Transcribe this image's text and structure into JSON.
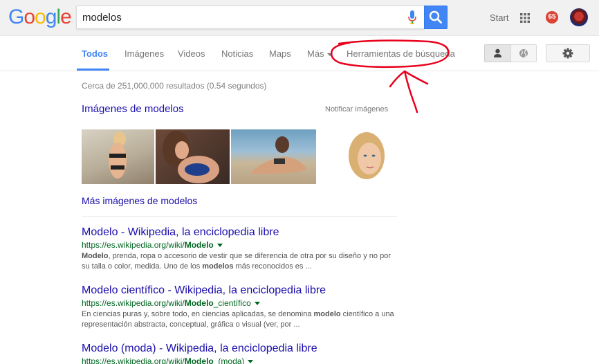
{
  "header": {
    "logo_letters": [
      {
        "char": "G",
        "color": "#4285f4"
      },
      {
        "char": "o",
        "color": "#ea4335"
      },
      {
        "char": "o",
        "color": "#fbbc05"
      },
      {
        "char": "g",
        "color": "#4285f4"
      },
      {
        "char": "l",
        "color": "#34a853"
      },
      {
        "char": "e",
        "color": "#ea4335"
      }
    ],
    "search_value": "modelos",
    "start_label": "Start",
    "notifications_count": "65"
  },
  "nav": {
    "tabs": [
      "Todos",
      "Imágenes",
      "Videos",
      "Noticias",
      "Maps",
      "Más",
      "Herramientas de búsqueda"
    ]
  },
  "results": {
    "stats": "Cerca de 251,000,000 resultados (0.54 segundos)",
    "images_heading": "Imágenes de modelos",
    "report_images": "Notificar imágenes",
    "more_images": "Más imágenes de modelos",
    "items": [
      {
        "title": "Modelo - Wikipedia, la enciclopedia libre",
        "url_prefix": "https://es.wikipedia.org/wiki/",
        "url_bold": "Modelo",
        "url_suffix": "",
        "snippet_bold1": "Modelo",
        "snippet_a": ", prenda, ropa o accesorio de vestir que se diferencia de otra por su diseño y no por su talla o color, medida. Uno de los ",
        "snippet_bold2": "modelos",
        "snippet_b": " más reconocidos es ..."
      },
      {
        "title": "Modelo científico - Wikipedia, la enciclopedia libre",
        "url_prefix": "https://es.wikipedia.org/wiki/",
        "url_bold": "Modelo",
        "url_suffix": "_científico",
        "snippet_bold1": "",
        "snippet_a": "En ciencias puras y, sobre todo, en ciencias aplicadas, se denomina ",
        "snippet_bold2": "modelo",
        "snippet_b": " científico a una representación abstracta, conceptual, gráfica o visual (ver, por ..."
      },
      {
        "title": "Modelo (moda) - Wikipedia, la enciclopedia libre",
        "url_prefix": "https://es.wikipedia.org/wiki/",
        "url_bold": "Modelo",
        "url_suffix": "_(moda)",
        "snippet_bold1": "",
        "snippet_a": "",
        "snippet_bold2": "",
        "snippet_b": ""
      }
    ]
  },
  "colors": {
    "accent": "#4285f4",
    "link": "#1a0dab",
    "url": "#006621",
    "annotation": "#e8001c"
  },
  "icons": [
    "microphone-icon",
    "search-icon",
    "apps-grid-icon",
    "person-icon",
    "globe-icon",
    "gear-icon"
  ]
}
